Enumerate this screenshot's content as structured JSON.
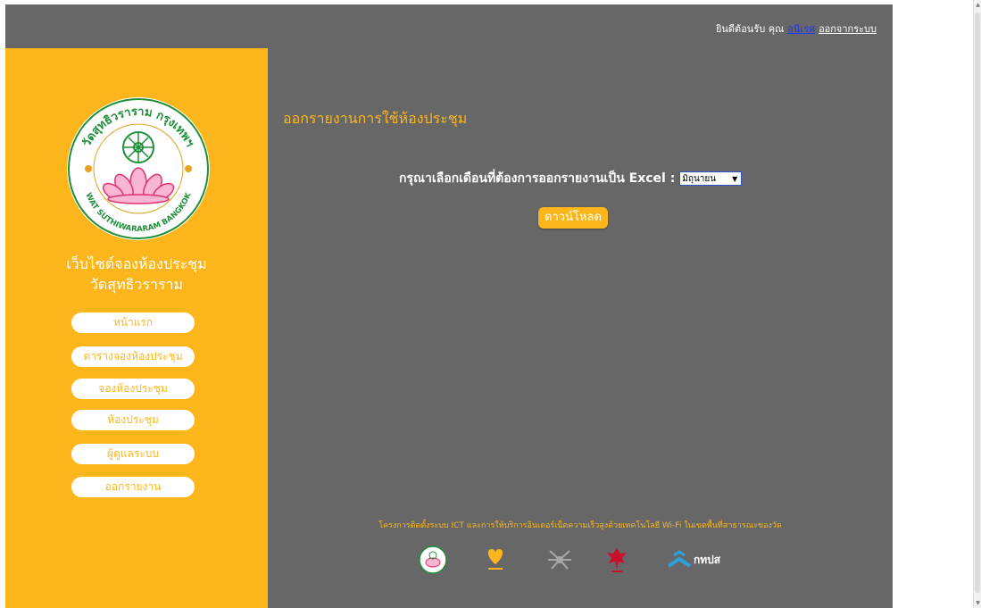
{
  "header": {
    "welcome_text": "ยินดีต้อนรับ คุณ",
    "username": "อนิเรศ",
    "logout_label": "ออกจากระบบ"
  },
  "sidebar": {
    "logo_text_top": "วัดสุทธิวราราม กรุงเทพฯ",
    "logo_text_bottom": "WAT SUTHIWARARAM BANGKOK",
    "site_title_line1": "เว็บไซต์จองห้องประชุม",
    "site_title_line2": "วัดสุทธิวราราม",
    "nav": [
      {
        "label": "หน้าแรก"
      },
      {
        "label": "ตารางจองห้องประชุม"
      },
      {
        "label": "จองห้องประชุม"
      },
      {
        "label": "ห้องประชุม"
      },
      {
        "label": "ผู้ดูแลระบบ"
      },
      {
        "label": "ออกรายงาน"
      }
    ]
  },
  "main": {
    "heading": "ออกรายงานการใช้ห้องประชุม",
    "prompt": "กรุณาเลือกเดือนที่ต้องการออกรายงานเป็น Excel :",
    "month_selected": "มิถุนายน",
    "download_label": "ดาวน์โหลด",
    "footer_text": "โครงการติดตั้งระบบ ICT และการให้บริการอินเตอร์เน็ตความเร็วสูงด้วยเทคโนโลยี Wi-Fi ในเขตพื้นที่สาธารณะของวัด",
    "partner_label": "กทปส"
  },
  "colors": {
    "accent": "#fcb61c",
    "panel": "#676767",
    "user_link": "#1a39ff"
  }
}
